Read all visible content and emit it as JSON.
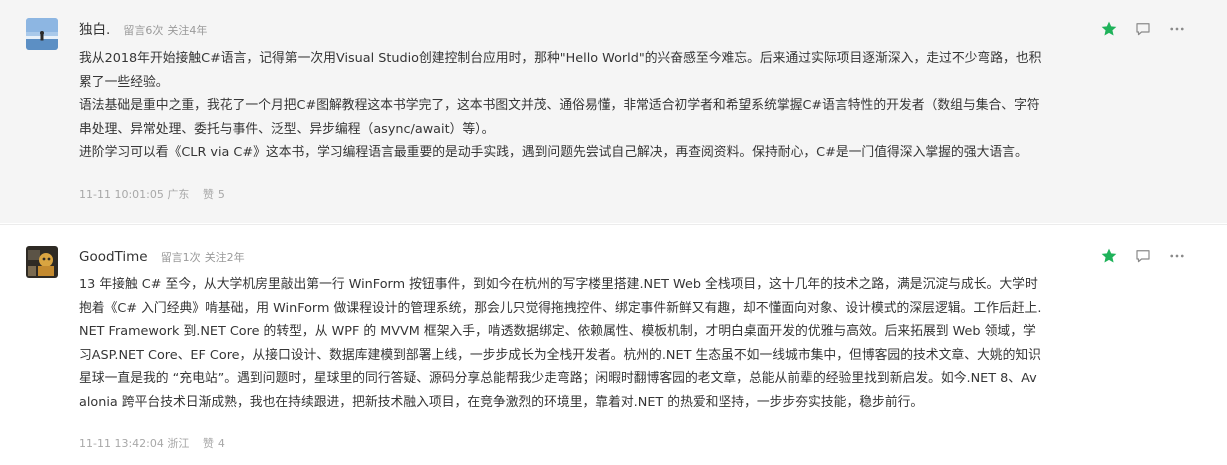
{
  "comments": [
    {
      "nickname": "独白.",
      "meta_messages": "留言6次",
      "meta_follow": "关注4年",
      "paragraphs": [
        "我从2018年开始接触C#语言，记得第一次用Visual Studio创建控制台应用时，那种\"Hello World\"的兴奋感至今难忘。后来通过实际项目逐渐深入，走过不少弯路，也积累了一些经验。",
        "语法基础是重中之重，我花了一个月把C#图解教程这本书学完了，这本书图文并茂、通俗易懂，非常适合初学者和希望系统掌握C#语言特性的开发者（数组与集合、字符串处理、异常处理、委托与事件、泛型、异步编程（async/await）等）。",
        "进阶学习可以看《CLR via C#》这本书，学习编程语言最重要的是动手实践，遇到问题先尝试自己解决，再查阅资料。保持耐心，C#是一门值得深入掌握的强大语言。"
      ],
      "time": "11-11 10:01:05",
      "location": "广东",
      "like_label": "赞",
      "like_count": "5",
      "icons": [
        "star-icon",
        "reply-icon",
        "more-icon"
      ]
    },
    {
      "nickname": "GoodTime",
      "meta_messages": "留言1次",
      "meta_follow": "关注2年",
      "paragraphs": [
        "13 年接触 C# 至今，从大学机房里敲出第一行 WinForm 按钮事件，到如今在杭州的写字楼里搭建.NET Web 全栈项目，这十几年的技术之路，满是沉淀与成长。大学时抱着《C# 入门经典》啃基础，用 WinForm 做课程设计的管理系统，那会儿只觉得拖拽控件、绑定事件新鲜又有趣，却不懂面向对象、设计模式的深层逻辑。工作后赶上.NET Framework 到.NET Core 的转型，从 WPF 的 MVVM 框架入手，啃透数据绑定、依赖属性、模板机制，才明白桌面开发的优雅与高效。后来拓展到 Web 领域，学习ASP.NET Core、EF Core，从接口设计、数据库建模到部署上线，一步步成长为全栈开发者。杭州的.NET 生态虽不如一线城市集中，但博客园的技术文章、大姚的知识星球一直是我的 “充电站”。遇到问题时，星球里的同行答疑、源码分享总能帮我少走弯路；闲暇时翻博客园的老文章，总能从前辈的经验里找到新启发。如今.NET 8、Avalonia 跨平台技术日渐成熟，我也在持续跟进，把新技术融入项目，在竞争激烈的环境里，靠着对.NET 的热爱和坚持，一步步夯实技能，稳步前行。"
      ],
      "time": "11-11 13:42:04",
      "location": "浙江",
      "like_label": "赞",
      "like_count": "4",
      "icons": [
        "star-icon",
        "reply-icon",
        "more-icon"
      ]
    }
  ],
  "colors": {
    "star": "#1fb25a",
    "icon_gray": "#8a8a8a",
    "first_bg": "#f5f5f5",
    "meta": "#9a9a9a"
  }
}
